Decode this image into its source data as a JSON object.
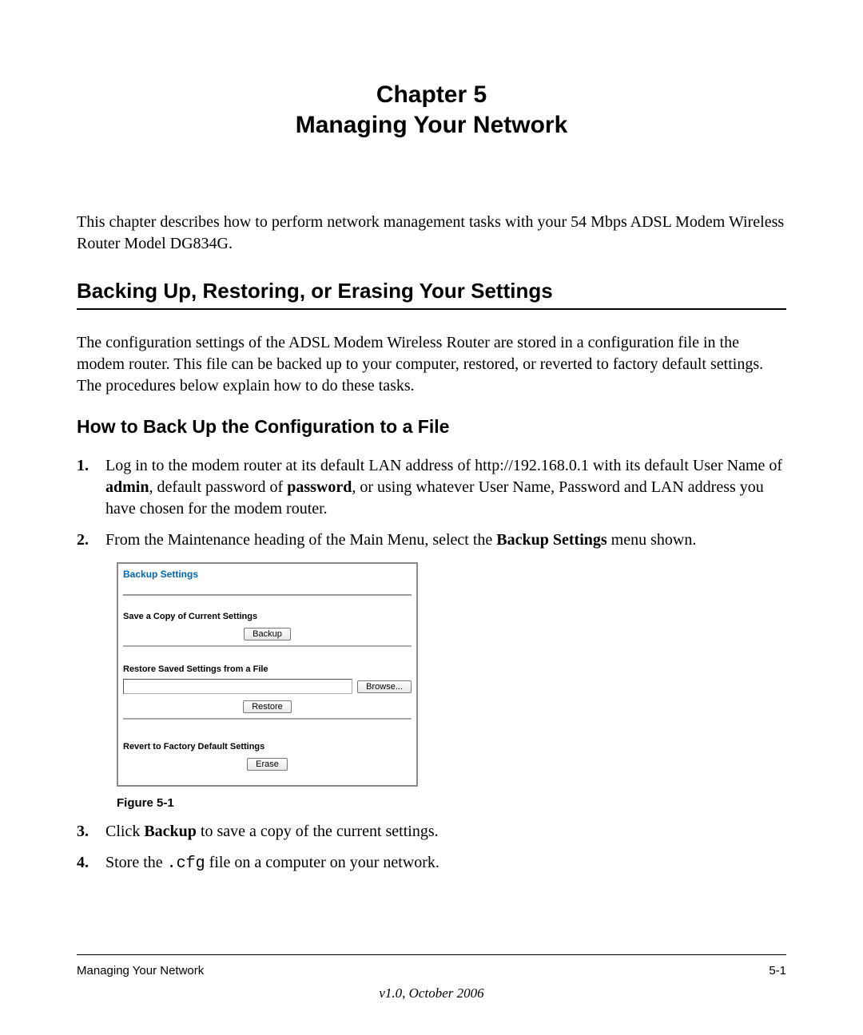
{
  "chapter": {
    "line1": "Chapter 5",
    "line2": "Managing Your Network"
  },
  "intro": "This chapter describes how to perform network management tasks with your 54 Mbps ADSL Modem Wireless Router Model DG834G.",
  "h1": "Backing Up, Restoring, or Erasing Your Settings",
  "para1": "The configuration settings of the ADSL Modem Wireless Router are stored in a configuration file in the modem router. This file can be backed up to your computer, restored, or reverted to factory default settings. The procedures below explain how to do these tasks.",
  "h2": "How to Back Up the Configuration to a File",
  "steps": {
    "s1": {
      "num": "1.",
      "t1": "Log in to the modem router at its default LAN address of http://192.168.0.1 with its default User Name of ",
      "b1": "admin",
      "t2": ", default password of ",
      "b2": "password",
      "t3": ", or using whatever User Name, Password and LAN address you have chosen for the modem router."
    },
    "s2": {
      "num": "2.",
      "t1": "From the Maintenance heading of the Main Menu, select the ",
      "b1": "Backup Settings",
      "t2": " menu shown."
    },
    "s3": {
      "num": "3.",
      "t1": "Click ",
      "b1": "Backup",
      "t2": " to save a copy of the current settings."
    },
    "s4": {
      "num": "4.",
      "t1": "Store the ",
      "code": ".cfg",
      "t2": " file on a computer on your network."
    }
  },
  "figure": {
    "title": "Backup Settings",
    "sec1": "Save a Copy of Current Settings",
    "btnBackup": "Backup",
    "sec2": "Restore Saved Settings from a File",
    "btnBrowse": "Browse...",
    "btnRestore": "Restore",
    "sec3": "Revert to Factory Default Settings",
    "btnErase": "Erase",
    "caption": "Figure 5-1"
  },
  "footer": {
    "left": "Managing Your Network",
    "right": "5-1",
    "version": "v1.0, October 2006"
  }
}
